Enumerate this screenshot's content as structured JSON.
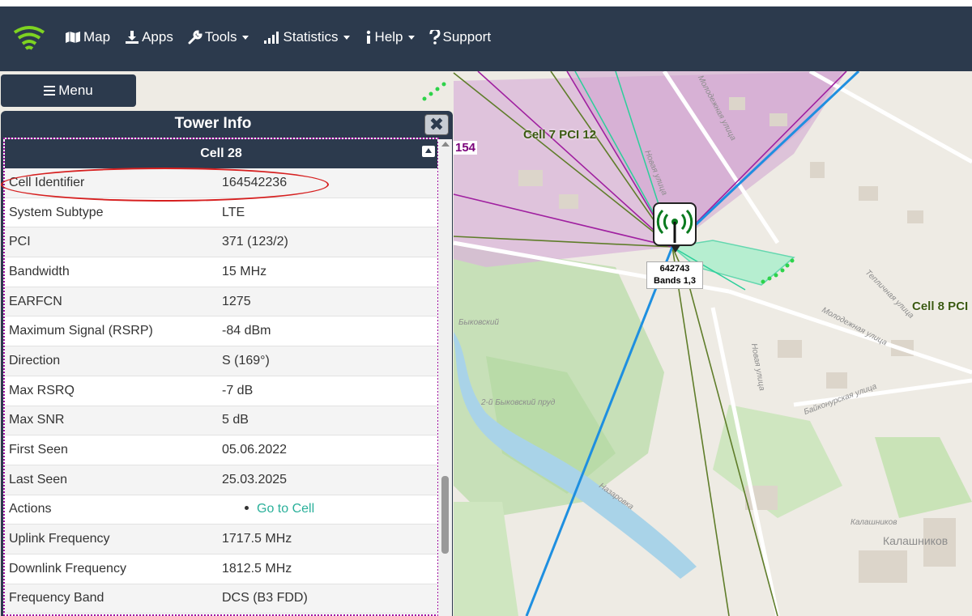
{
  "nav": {
    "items": [
      {
        "label": "Map",
        "icon": "map-icon",
        "dropdown": false
      },
      {
        "label": "Apps",
        "icon": "download-icon",
        "dropdown": false
      },
      {
        "label": "Tools",
        "icon": "wrench-icon",
        "dropdown": true
      },
      {
        "label": "Statistics",
        "icon": "signal-bars-icon",
        "dropdown": true
      },
      {
        "label": "Help",
        "icon": "info-icon",
        "dropdown": true
      },
      {
        "label": "Support",
        "icon": "question-icon",
        "dropdown": false
      }
    ]
  },
  "menu_button": {
    "label": "Menu"
  },
  "map": {
    "labels": {
      "cell7": "Cell 7 PCI 12",
      "cell8": "Cell 8 PCI",
      "partial": "154"
    },
    "tower_tag": {
      "id": "642743",
      "bands": "Bands 1,3"
    },
    "streets": {
      "s1": "Молодежная улица",
      "s2": "Новая улица",
      "s3": "Тепличная улица",
      "s4": "Байконурская улица",
      "s5": "Молодежная улица",
      "s6": "Новая улица",
      "s7": "Назаровка",
      "s8": "2-й Быковский пруд",
      "s9": "Калашников",
      "s10": "Калашников",
      "s11": "Быковский"
    },
    "colors": {
      "purple": "#a020a0",
      "green": "#5f7d2a",
      "teal": "#2bcf9a",
      "blue": "#1e8fe0"
    }
  },
  "panel": {
    "title": "Tower Info",
    "cell_title": "Cell 28",
    "rows": [
      {
        "key": "Cell Identifier",
        "value": "164542236"
      },
      {
        "key": "System Subtype",
        "value": "LTE"
      },
      {
        "key": "PCI",
        "value": "371 (123/2)"
      },
      {
        "key": "Bandwidth",
        "value": "15 MHz"
      },
      {
        "key": "EARFCN",
        "value": "1275"
      },
      {
        "key": "Maximum Signal (RSRP)",
        "value": "-84 dBm"
      },
      {
        "key": "Direction",
        "value": "S (169°)"
      },
      {
        "key": "Max RSRQ",
        "value": "-7 dB"
      },
      {
        "key": "Max SNR",
        "value": "5 dB"
      },
      {
        "key": "First Seen",
        "value": "05.06.2022"
      },
      {
        "key": "Last Seen",
        "value": "25.03.2025"
      },
      {
        "key": "Actions",
        "value": "Go to Cell"
      },
      {
        "key": "Uplink Frequency",
        "value": "1717.5 MHz"
      },
      {
        "key": "Downlink Frequency",
        "value": "1812.5 MHz"
      },
      {
        "key": "Frequency Band",
        "value": "DCS (B3 FDD)"
      }
    ]
  }
}
